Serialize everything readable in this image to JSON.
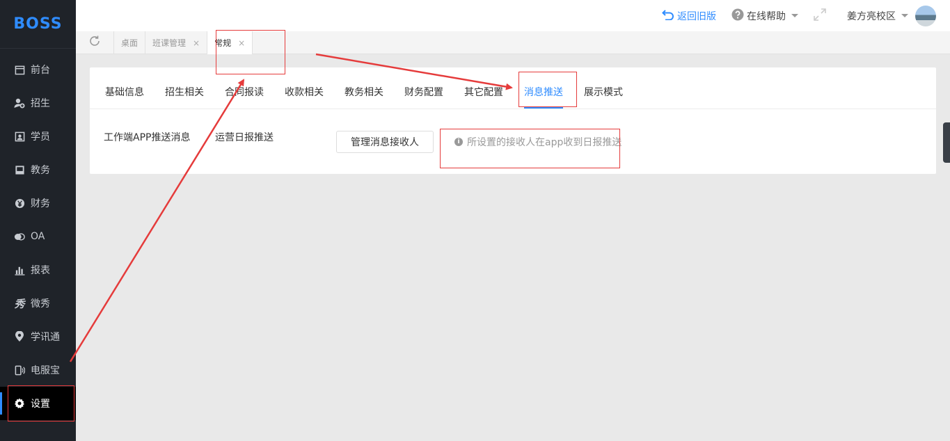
{
  "brand": {
    "logo": "BOSS"
  },
  "sidebar": {
    "items": [
      {
        "label": "前台",
        "icon": "calendar-icon"
      },
      {
        "label": "招生",
        "icon": "user-add-icon"
      },
      {
        "label": "学员",
        "icon": "id-card-icon"
      },
      {
        "label": "教务",
        "icon": "book-icon"
      },
      {
        "label": "财务",
        "icon": "yen-icon"
      },
      {
        "label": "OA",
        "icon": "chat-icon"
      },
      {
        "label": "报表",
        "icon": "bar-chart-icon"
      },
      {
        "label": "微秀",
        "icon": "xiu-icon"
      },
      {
        "label": "学讯通",
        "icon": "location-icon"
      },
      {
        "label": "电服宝",
        "icon": "phone-icon"
      },
      {
        "label": "设置",
        "icon": "gear-icon",
        "active": true
      }
    ]
  },
  "header": {
    "back_label": "返回旧版",
    "help_label": "在线帮助",
    "campus_label": "姜方亮校区"
  },
  "page_tabs": [
    {
      "label": "桌面",
      "closable": false
    },
    {
      "label": "班课管理",
      "closable": true
    },
    {
      "label": "常规",
      "closable": true,
      "active": true
    }
  ],
  "close_glyph": "×",
  "settings": {
    "tabs": [
      "基础信息",
      "招生相关",
      "合同报读",
      "收款相关",
      "教务相关",
      "财务配置",
      "其它配置",
      "消息推送",
      "展示模式"
    ],
    "active_tab": "消息推送",
    "row_label": "工作端APP推送消息",
    "row_item": "运营日报推送",
    "manage_button": "管理消息接收人",
    "hint": "所设置的接收人在app收到日报推送"
  },
  "colors": {
    "accent": "#2f8cff",
    "sidebar_bg": "#1f2329",
    "annotation": "#e53b3b"
  }
}
